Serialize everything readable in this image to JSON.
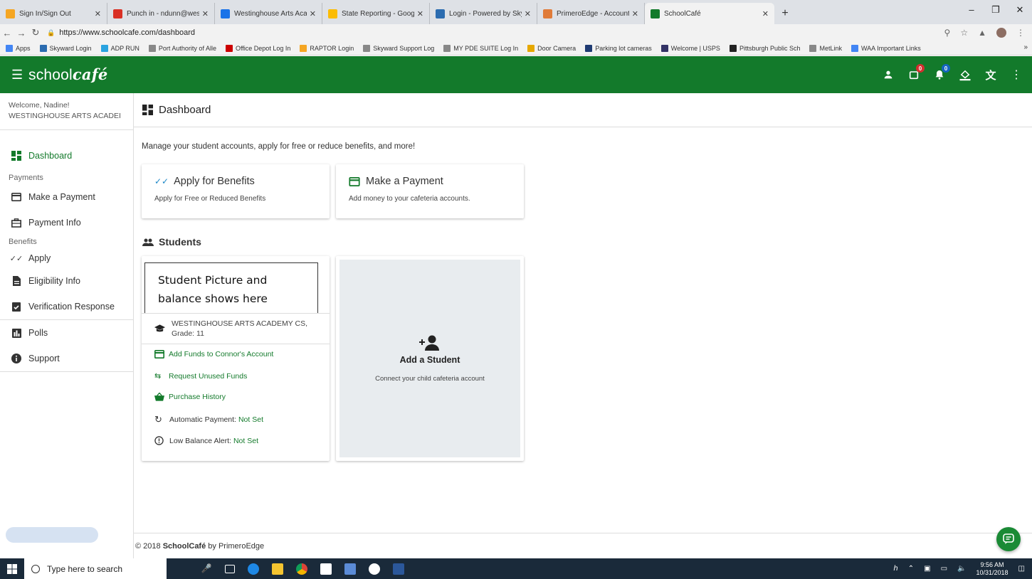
{
  "browser": {
    "tabs": [
      {
        "title": "Sign In/Sign Out",
        "icon": "sign-in-favicon",
        "color": "#f5a623"
      },
      {
        "title": "Punch in - ndunn@westinghouse",
        "icon": "gmail-favicon",
        "color": "#d93025"
      },
      {
        "title": "Westinghouse Arts Academy Cha",
        "icon": "calendar-favicon",
        "color": "#1a73e8"
      },
      {
        "title": "State Reporting - Google Drive",
        "icon": "drive-favicon",
        "color": "#fbbc04"
      },
      {
        "title": "Login - Powered by Skyward",
        "icon": "skyward-favicon",
        "color": "#2b6cb0"
      },
      {
        "title": "PrimeroEdge - Accounts",
        "icon": "primeroedge-favicon",
        "color": "#e07b39"
      },
      {
        "title": "SchoolCafé",
        "icon": "schoolcafe-favicon",
        "color": "#137a2b",
        "active": true
      }
    ],
    "new_tab": "+",
    "url": "https://www.schoolcafe.com/dashboard",
    "bookmarks": [
      {
        "label": "Apps",
        "color": "#4285f4"
      },
      {
        "label": "Skyward Login",
        "color": "#2b6cb0"
      },
      {
        "label": "ADP RUN",
        "color": "#2aa3e0"
      },
      {
        "label": "Port Authority of Alle",
        "color": "#888888"
      },
      {
        "label": "Office Depot Log In",
        "color": "#cc0000"
      },
      {
        "label": "RAPTOR Login",
        "color": "#f5a623"
      },
      {
        "label": "Skyward Support Log",
        "color": "#888888"
      },
      {
        "label": "MY PDE SUITE Log In",
        "color": "#888888"
      },
      {
        "label": "Door Camera",
        "color": "#e6a800"
      },
      {
        "label": "Parking lot cameras",
        "color": "#1f3b73"
      },
      {
        "label": "Welcome | USPS",
        "color": "#333366"
      },
      {
        "label": "Pittsburgh Public Sch",
        "color": "#222222"
      },
      {
        "label": "MetLink",
        "color": "#888888"
      },
      {
        "label": "WAA Important Links",
        "color": "#4285f4"
      }
    ],
    "bookmarks_more": "»"
  },
  "header": {
    "logo_plain": "school",
    "logo_italic": "café",
    "badges": {
      "cart": "0",
      "notifications": "0"
    },
    "accent": "#137a2b"
  },
  "sidebar": {
    "welcome": "Welcome, Nadine!",
    "school": "WESTINGHOUSE ARTS ACADEI",
    "dashboard": "Dashboard",
    "payments_group": "Payments",
    "make_payment": "Make a Payment",
    "payment_info": "Payment Info",
    "benefits_group": "Benefits",
    "apply": "Apply",
    "eligibility": "Eligibility Info",
    "verification": "Verification Response",
    "polls": "Polls",
    "support": "Support"
  },
  "main": {
    "title": "Dashboard",
    "intro": "Manage your student accounts, apply for free or reduce benefits, and more!",
    "apply_card": {
      "title": "Apply for Benefits",
      "subtitle": "Apply for Free or Reduced Benefits"
    },
    "payment_card": {
      "title": "Make a Payment",
      "subtitle": "Add money to your cafeteria accounts."
    },
    "students_heading": "Students",
    "student": {
      "placeholder_line1": "Student Picture and",
      "placeholder_line2": "balance shows here",
      "school": "WESTINGHOUSE ARTS ACADEMY CS,",
      "grade": "Grade: 11",
      "add_funds": "Add Funds to Connor's Account",
      "request_unused": "Request Unused Funds",
      "purchase_history": "Purchase History",
      "auto_payment_label": "Automatic Payment:",
      "auto_payment_value": "Not Set",
      "low_balance_label": "Low Balance Alert:",
      "low_balance_value": "Not Set"
    },
    "add_student": {
      "title": "Add a Student",
      "subtitle": "Connect your child cafeteria account"
    }
  },
  "footer": {
    "prefix": "© 2018",
    "brand": "SchoolCafé",
    "suffix": "by PrimeroEdge"
  },
  "taskbar": {
    "search_placeholder": "Type here to search",
    "time": "9:56 AM",
    "date": "10/31/2018"
  }
}
